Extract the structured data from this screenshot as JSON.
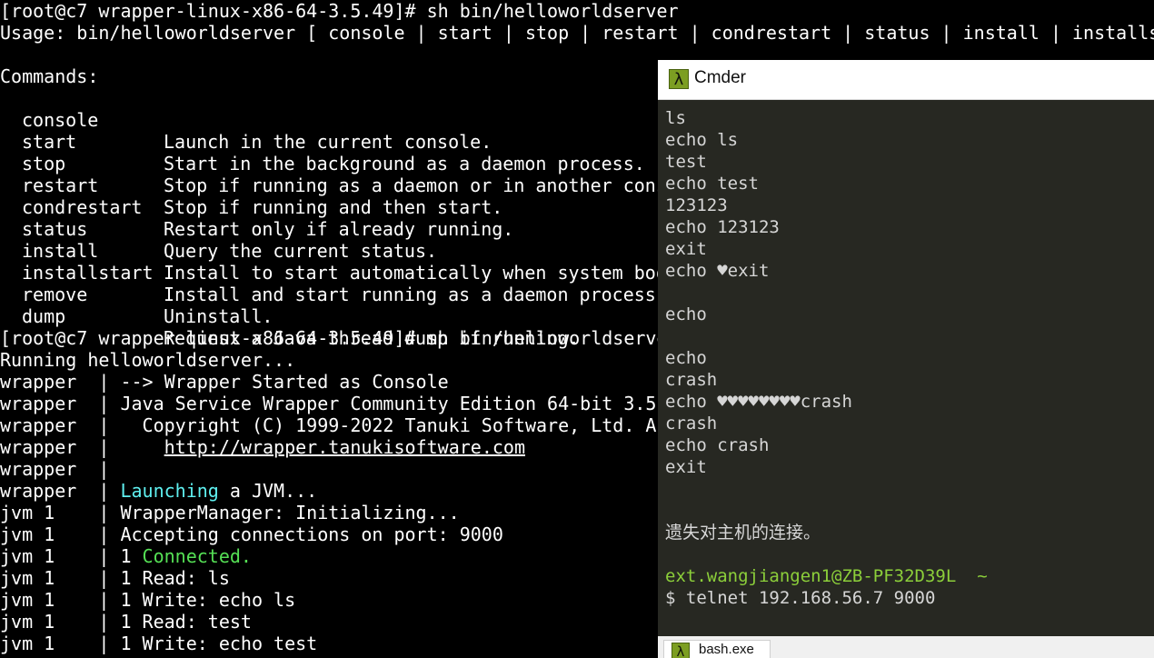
{
  "terminal": {
    "prompt_line_1": "[root@c7 wrapper-linux-x86-64-3.5.49]# sh bin/helloworldserver",
    "usage_line": "Usage: bin/helloworldserver [ console | start | stop | restart | condrestart | status | install | installs",
    "commands_header": "Commands:",
    "commands": [
      {
        "name": "console",
        "desc": "Launch in the current console."
      },
      {
        "name": "start",
        "desc": "Start in the background as a daemon process."
      },
      {
        "name": "stop",
        "desc": "Stop if running as a daemon or in another cons"
      },
      {
        "name": "restart",
        "desc": "Stop if running and then start."
      },
      {
        "name": "condrestart",
        "desc": "Restart only if already running."
      },
      {
        "name": "status",
        "desc": "Query the current status."
      },
      {
        "name": "install",
        "desc": "Install to start automatically when system boo"
      },
      {
        "name": "installstart",
        "desc": "Install and start running as a daemon process"
      },
      {
        "name": "remove",
        "desc": "Uninstall."
      },
      {
        "name": "dump",
        "desc": "Request a Java thread dump if running."
      }
    ],
    "prompt_line_2": "[root@c7 wrapper-linux-x86-64-3.5.49]# sh bin/helloworldserver console",
    "running_line": "Running helloworldserver...",
    "wrapper_started": "wrapper  | --> Wrapper Started as Console",
    "wrapper_edition": "wrapper  | Java Service Wrapper Community Edition 64-bit 3.5",
    "wrapper_copyright": "wrapper  |   Copyright (C) 1999-2022 Tanuki Software, Ltd. All Rights Reserved.",
    "wrapper_url_prefix": "wrapper  |     ",
    "wrapper_url": "http://wrapper.tanukisoftware.com",
    "wrapper_blank": "wrapper  |",
    "launching_prefix": "wrapper  | ",
    "launching_word": "Launching",
    "launching_suffix": " a JVM...",
    "jvm_init": "jvm 1    | WrapperManager: Initializing...",
    "jvm_accept": "jvm 1    | Accepting connections on port: 9000",
    "jvm_connected_prefix": "jvm 1    | 1 ",
    "jvm_connected_word": "Connected.",
    "jvm_read_ls": "jvm 1    | 1 Read: ls",
    "jvm_write_ls": "jvm 1    | 1 Write: echo ls",
    "jvm_read_test": "jvm 1    | 1 Read: test",
    "jvm_write_test": "jvm 1    | 1 Write: echo test"
  },
  "cmder": {
    "title": "Cmder",
    "icon": "lambda-icon",
    "lines": [
      "ls",
      "echo ls",
      "test",
      "echo test",
      "123123",
      "echo 123123",
      "exit",
      "echo ♥exit",
      "",
      "echo",
      "",
      "echo",
      "crash",
      "echo ♥♥♥♥♥♥♥♥crash",
      "crash",
      "echo crash",
      "exit"
    ],
    "lost_connection": "遗失对主机的连接。",
    "user_host": "ext.wangjiangen1@ZB-PF32D39L",
    "cwd": "~",
    "command_line": "$ telnet 192.168.56.7 9000",
    "tab_label": "bash.exe"
  },
  "colors": {
    "terminal_bg": "#000000",
    "cmder_bg": "#272822",
    "cyan_highlight": "#5ff0f0",
    "green_highlight": "#55e055",
    "cmder_prompt_green": "#8ccf3a"
  }
}
